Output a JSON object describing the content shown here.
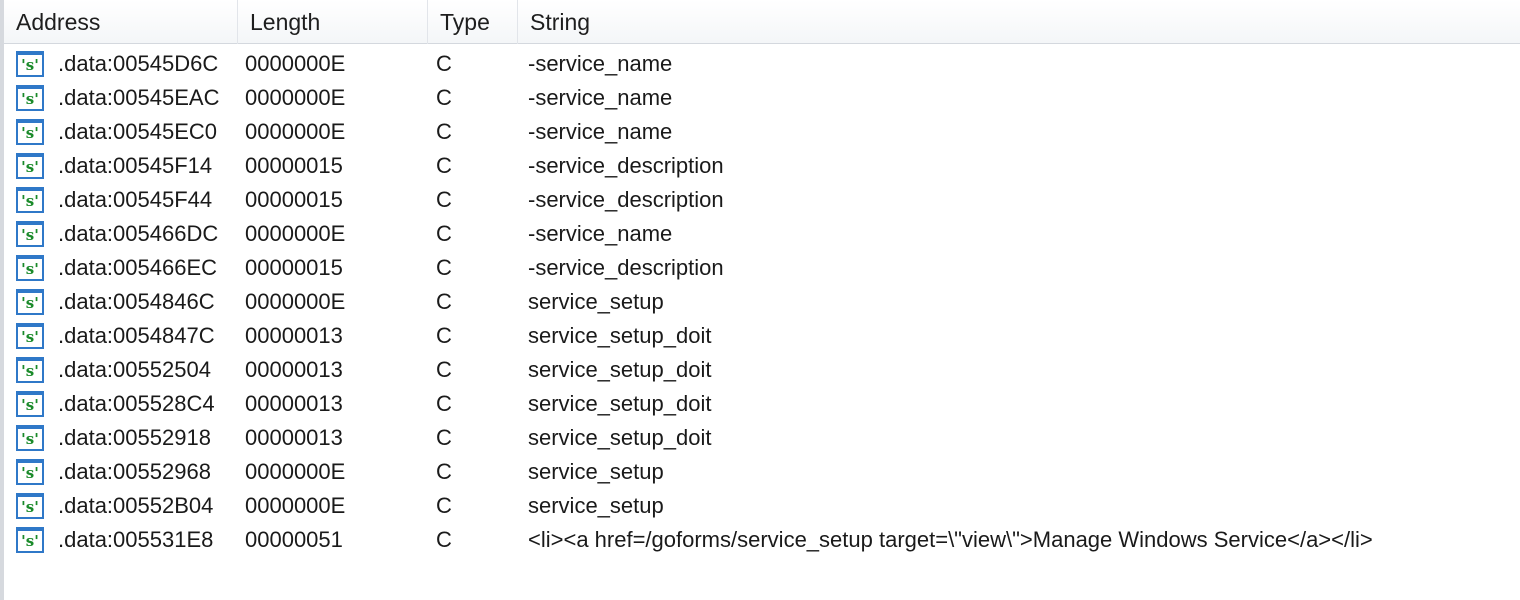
{
  "columns": {
    "address": "Address",
    "length": "Length",
    "type": "Type",
    "string": "String"
  },
  "row_icon": {
    "name": "string-literal-icon",
    "glyph": "'s'",
    "border_color": "#2f78c8",
    "glyph_color": "#1a8a2a"
  },
  "rows": [
    {
      "address": ".data:00545D6C",
      "length": "0000000E",
      "type": "C",
      "string": "-service_name"
    },
    {
      "address": ".data:00545EAC",
      "length": "0000000E",
      "type": "C",
      "string": "-service_name"
    },
    {
      "address": ".data:00545EC0",
      "length": "0000000E",
      "type": "C",
      "string": "-service_name"
    },
    {
      "address": ".data:00545F14",
      "length": "00000015",
      "type": "C",
      "string": "-service_description"
    },
    {
      "address": ".data:00545F44",
      "length": "00000015",
      "type": "C",
      "string": "-service_description"
    },
    {
      "address": ".data:005466DC",
      "length": "0000000E",
      "type": "C",
      "string": "-service_name"
    },
    {
      "address": ".data:005466EC",
      "length": "00000015",
      "type": "C",
      "string": "-service_description"
    },
    {
      "address": ".data:0054846C",
      "length": "0000000E",
      "type": "C",
      "string": "service_setup"
    },
    {
      "address": ".data:0054847C",
      "length": "00000013",
      "type": "C",
      "string": "service_setup_doit"
    },
    {
      "address": ".data:00552504",
      "length": "00000013",
      "type": "C",
      "string": "service_setup_doit"
    },
    {
      "address": ".data:005528C4",
      "length": "00000013",
      "type": "C",
      "string": "service_setup_doit"
    },
    {
      "address": ".data:00552918",
      "length": "00000013",
      "type": "C",
      "string": "service_setup_doit"
    },
    {
      "address": ".data:00552968",
      "length": "0000000E",
      "type": "C",
      "string": "service_setup"
    },
    {
      "address": ".data:00552B04",
      "length": "0000000E",
      "type": "C",
      "string": "service_setup"
    },
    {
      "address": ".data:005531E8",
      "length": "00000051",
      "type": "C",
      "string": "<li><a href=/goforms/service_setup target=\\\"view\\\">Manage Windows Service</a></li>"
    }
  ]
}
